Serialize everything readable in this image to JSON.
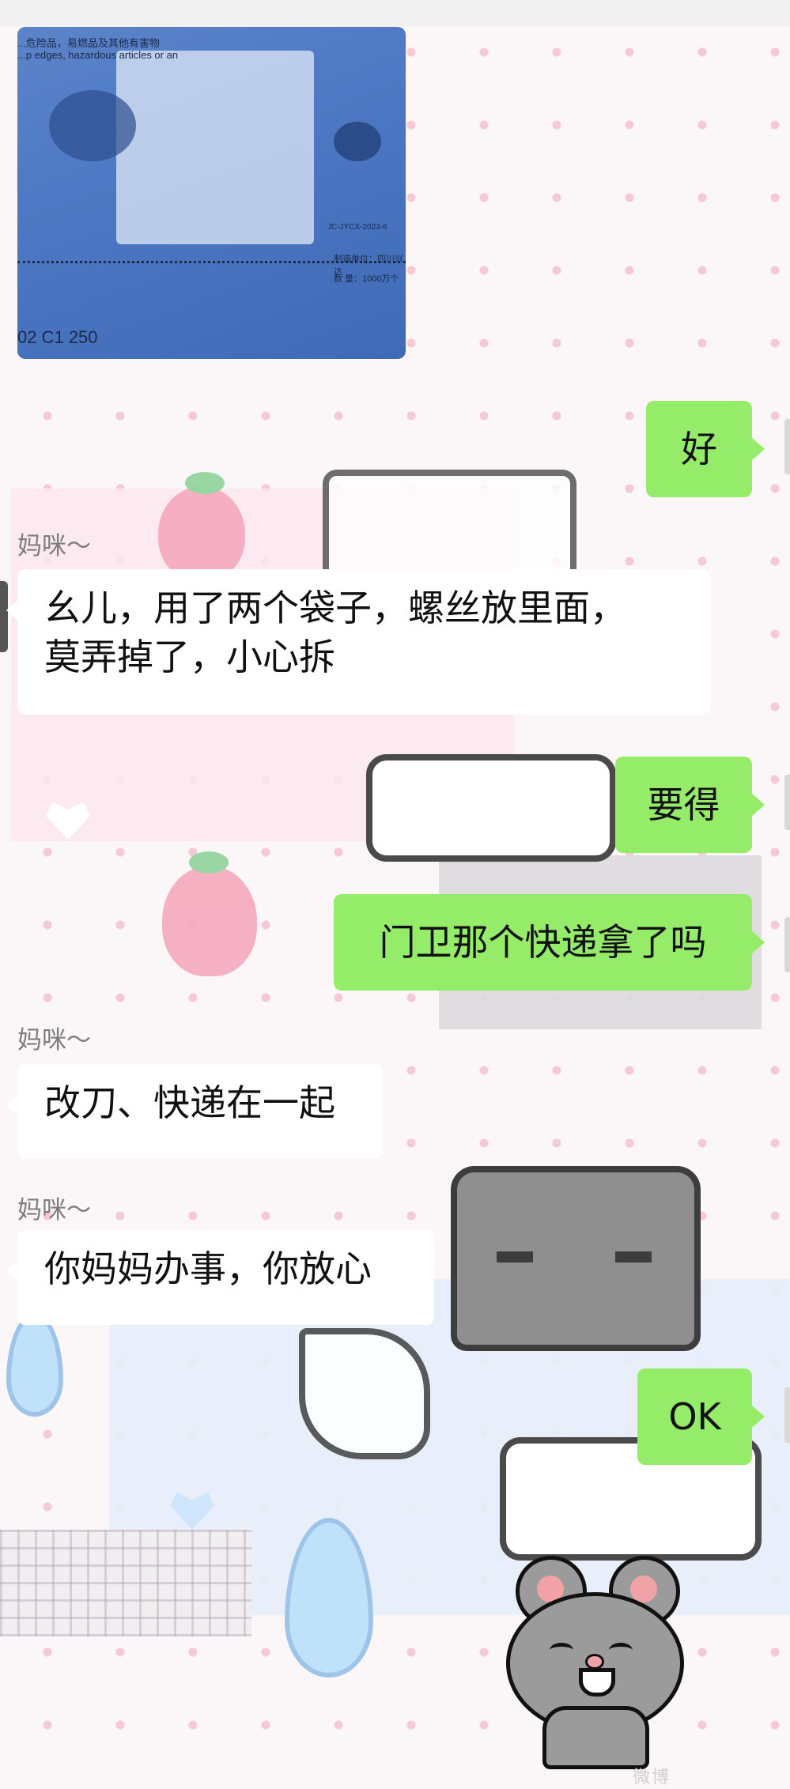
{
  "photo": {
    "caption_lines": [
      "...危险品，易燃品及其他有害物",
      "...p edges, hazardous articles or an"
    ],
    "label_lines": [
      "制造单位：四川兴达",
      "数 量：1000万个"
    ],
    "code_text": "02 C1 250",
    "tag_text": "JC-JYCX-2023-6"
  },
  "messages": [
    {
      "id": "m1",
      "side": "out",
      "text": "好"
    },
    {
      "id": "m2",
      "side": "in",
      "sender": "妈咪～",
      "lines": [
        "幺儿，用了两个袋子，螺丝放里面，",
        "莫弄掉了，小心拆"
      ]
    },
    {
      "id": "m3",
      "side": "out",
      "text": "要得"
    },
    {
      "id": "m4",
      "side": "out",
      "text": "门卫那个快递拿了吗"
    },
    {
      "id": "m5",
      "side": "in",
      "sender": "妈咪～",
      "lines": [
        "改刀、快递在一起"
      ]
    },
    {
      "id": "m6",
      "side": "in",
      "sender": "妈咪～",
      "lines": [
        "你妈妈办事，你放心"
      ]
    },
    {
      "id": "m7",
      "side": "out",
      "text": "OK"
    }
  ],
  "watermark": "微博",
  "colors": {
    "outgoing_bubble": "#95ec69",
    "incoming_bubble": "#ffffff",
    "sender_name": "#7d7d7d",
    "background_dots": "#f5c9d7"
  }
}
